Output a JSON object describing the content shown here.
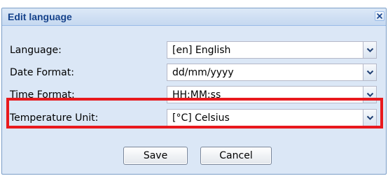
{
  "dialog": {
    "title": "Edit language",
    "close_icon": "close-icon"
  },
  "fields": [
    {
      "label": "Language:",
      "value": "[en] English"
    },
    {
      "label": "Date Format:",
      "value": "dd/mm/yyyy"
    },
    {
      "label": "Time Format:",
      "value": "HH:MM:ss"
    },
    {
      "label": "Temperature Unit:",
      "value": "[°C] Celsius"
    }
  ],
  "buttons": {
    "save_label": "Save",
    "cancel_label": "Cancel"
  },
  "colors": {
    "title_text": "#15428b",
    "dialog_background": "#dbe7f6",
    "highlight_border": "#e8191d",
    "trigger_arrow": "#1f3f73"
  }
}
